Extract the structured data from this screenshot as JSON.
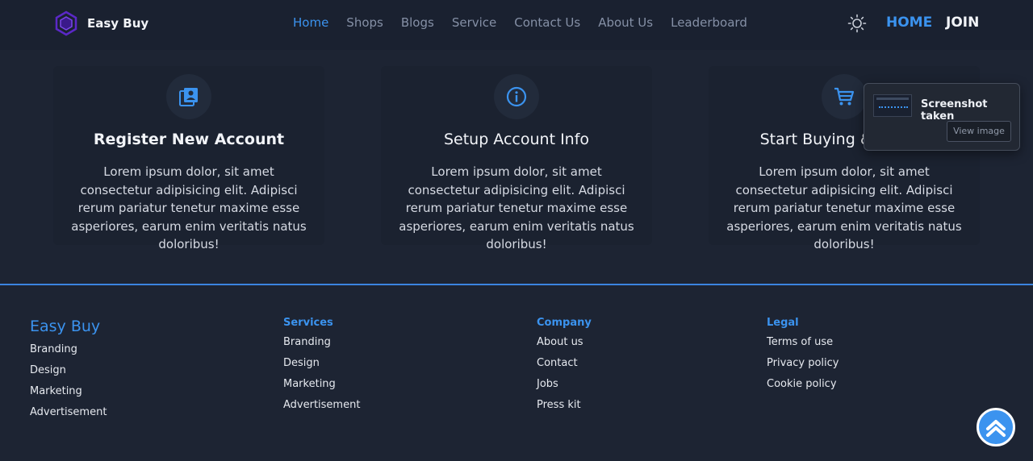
{
  "header": {
    "brand_name": "Easy Buy",
    "nav": [
      "Home",
      "Shops",
      "Blogs",
      "Service",
      "Contact Us",
      "About Us",
      "Leaderboard"
    ],
    "home_label": "HOME",
    "join_label": "JOIN"
  },
  "steps": [
    {
      "icon": "account-book-icon",
      "title": "Register New Account",
      "description": "Lorem ipsum dolor, sit amet consectetur adipisicing elit. Adipisci rerum pariatur tenetur maxime esse asperiores, earum enim veritatis natus doloribus!"
    },
    {
      "icon": "info-circle-icon",
      "title": "Setup Account Info",
      "description": "Lorem ipsum dolor, sit amet consectetur adipisicing elit. Adipisci rerum pariatur tenetur maxime esse asperiores, earum enim veritatis natus doloribus!"
    },
    {
      "icon": "shopping-cart-icon",
      "title": "Start Buying & Selling",
      "description": "Lorem ipsum dolor, sit amet consectetur adipisicing elit. Adipisci rerum pariatur tenetur maxime esse asperiores, earum enim veritatis natus doloribus!"
    }
  ],
  "toast": {
    "title": "Screenshot taken",
    "button_label": "View image"
  },
  "footer": {
    "brand": "Easy Buy",
    "brand_links": [
      "Branding",
      "Design",
      "Marketing",
      "Advertisement"
    ],
    "services": {
      "heading": "Services",
      "links": [
        "Branding",
        "Design",
        "Marketing",
        "Advertisement"
      ]
    },
    "company": {
      "heading": "Company",
      "links": [
        "About us",
        "Contact",
        "Jobs",
        "Press kit"
      ]
    },
    "legal": {
      "heading": "Legal",
      "links": [
        "Terms of use",
        "Privacy policy",
        "Cookie policy"
      ]
    }
  },
  "colors": {
    "accent": "#3b93ef",
    "background": "#1d2433",
    "header": "#1a2130",
    "logo": "#6a2fd6"
  }
}
